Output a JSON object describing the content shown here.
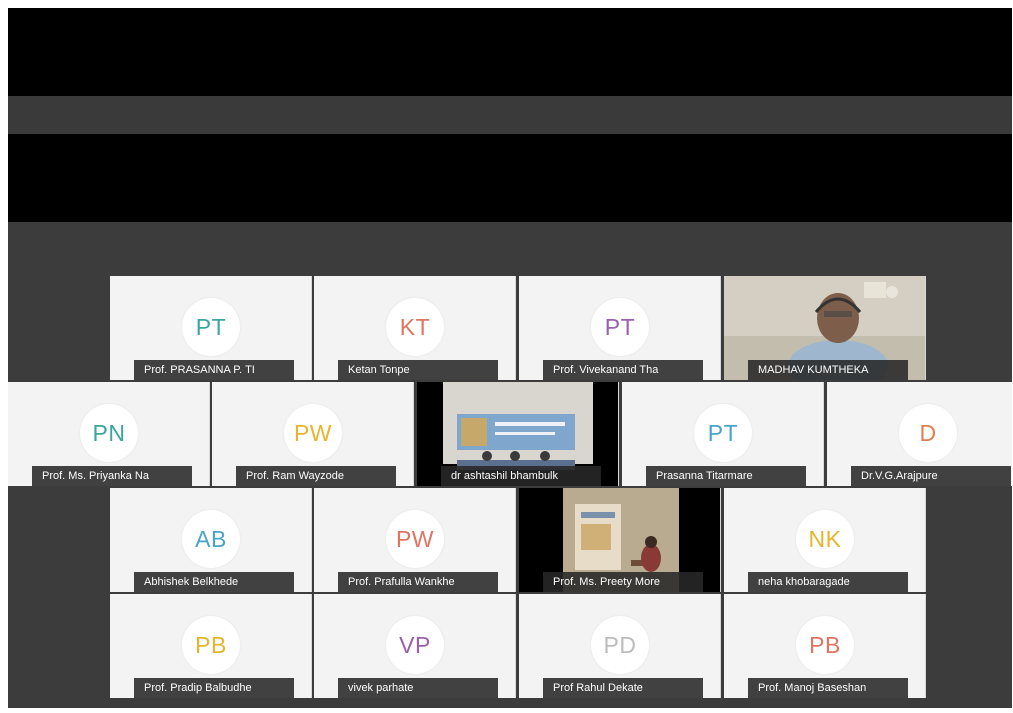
{
  "participants": [
    {
      "initials": "PT",
      "name": "Prof. PRASANNA P. TI",
      "color": "#3aa6a0"
    },
    {
      "initials": "KT",
      "name": "Ketan Tonpe",
      "color": "#e07462"
    },
    {
      "initials": "PT",
      "name": "Prof. Vivekanand Tha",
      "color": "#9a5fae"
    },
    {
      "initials": "",
      "name": "MADHAV KUMTHEKA",
      "color": ""
    },
    {
      "initials": "PN",
      "name": "Prof. Ms. Priyanka Na",
      "color": "#3aa6a0"
    },
    {
      "initials": "PW",
      "name": "Prof. Ram Wayzode",
      "color": "#e5b52d"
    },
    {
      "initials": "",
      "name": "dr ashtashil bhambulk",
      "color": ""
    },
    {
      "initials": "PT",
      "name": "Prasanna Titarmare",
      "color": "#4aa3c9"
    },
    {
      "initials": "D",
      "name": "Dr.V.G.Arajpure",
      "color": "#e07e54"
    },
    {
      "initials": "AB",
      "name": "Abhishek Belkhede",
      "color": "#4aa3c9"
    },
    {
      "initials": "PW",
      "name": "Prof. Prafulla Wankhe",
      "color": "#e07462"
    },
    {
      "initials": "",
      "name": "Prof. Ms. Preety More",
      "color": ""
    },
    {
      "initials": "NK",
      "name": "neha khobaragade",
      "color": "#e5b52d"
    },
    {
      "initials": "PB",
      "name": "Prof. Pradip Balbudhe",
      "color": "#e5b52d"
    },
    {
      "initials": "VP",
      "name": "vivek parhate",
      "color": "#9a5fae"
    },
    {
      "initials": "PD",
      "name": "Prof Rahul Dekate",
      "color": "#bcbcbc"
    },
    {
      "initials": "PB",
      "name": "Prof. Manoj Baseshan",
      "color": "#e07462"
    }
  ]
}
